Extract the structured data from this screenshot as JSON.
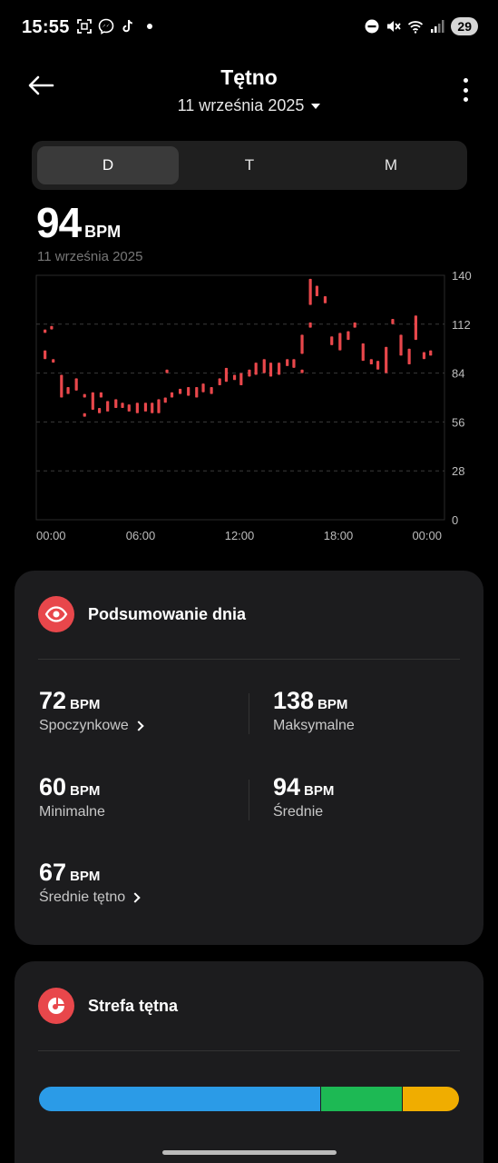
{
  "status_bar": {
    "time": "15:55",
    "battery": "29",
    "left_icons": [
      "screenshot-icon",
      "messenger-icon",
      "tiktok-icon",
      "notification-dot"
    ],
    "right_icons": [
      "dnd-icon",
      "mute-icon",
      "wifi-icon",
      "signal-icon"
    ]
  },
  "header": {
    "title": "Tętno",
    "date": "11 września 2025"
  },
  "tabs": [
    {
      "label": "D",
      "active": true
    },
    {
      "label": "T",
      "active": false
    },
    {
      "label": "M",
      "active": false
    }
  ],
  "summary_value": {
    "value": "94",
    "unit": "BPM",
    "date": "11 września 2025"
  },
  "chart_data": {
    "type": "candlestick-range",
    "x_ticks": [
      "00:00",
      "06:00",
      "12:00",
      "18:00",
      "00:00"
    ],
    "y_ticks": [
      "140",
      "112",
      "84",
      "56",
      "28",
      "0"
    ],
    "ylim": [
      0,
      140
    ],
    "xlim_hours": [
      0,
      24
    ],
    "color": "#e8474b",
    "grid": true,
    "ranges": [
      {
        "h": 0.2,
        "lo": 107,
        "hi": 109
      },
      {
        "h": 0.6,
        "lo": 109,
        "hi": 111
      },
      {
        "h": 0.2,
        "lo": 92,
        "hi": 97
      },
      {
        "h": 0.7,
        "lo": 90,
        "hi": 92
      },
      {
        "h": 1.2,
        "lo": 70,
        "hi": 83
      },
      {
        "h": 1.6,
        "lo": 72,
        "hi": 76
      },
      {
        "h": 2.1,
        "lo": 74,
        "hi": 81
      },
      {
        "h": 2.6,
        "lo": 59,
        "hi": 61
      },
      {
        "h": 2.6,
        "lo": 70,
        "hi": 72
      },
      {
        "h": 3.1,
        "lo": 63,
        "hi": 73
      },
      {
        "h": 3.5,
        "lo": 61,
        "hi": 64
      },
      {
        "h": 3.6,
        "lo": 70,
        "hi": 73
      },
      {
        "h": 4.0,
        "lo": 62,
        "hi": 68
      },
      {
        "h": 4.5,
        "lo": 64,
        "hi": 69
      },
      {
        "h": 4.9,
        "lo": 64,
        "hi": 67
      },
      {
        "h": 5.3,
        "lo": 62,
        "hi": 66
      },
      {
        "h": 5.8,
        "lo": 61,
        "hi": 67
      },
      {
        "h": 6.3,
        "lo": 62,
        "hi": 67
      },
      {
        "h": 6.7,
        "lo": 61,
        "hi": 67
      },
      {
        "h": 7.1,
        "lo": 61,
        "hi": 69
      },
      {
        "h": 7.5,
        "lo": 67,
        "hi": 70
      },
      {
        "h": 7.6,
        "lo": 84,
        "hi": 86
      },
      {
        "h": 7.9,
        "lo": 70,
        "hi": 73
      },
      {
        "h": 8.4,
        "lo": 72,
        "hi": 75
      },
      {
        "h": 8.9,
        "lo": 71,
        "hi": 76
      },
      {
        "h": 9.4,
        "lo": 70,
        "hi": 76
      },
      {
        "h": 9.8,
        "lo": 73,
        "hi": 78
      },
      {
        "h": 10.3,
        "lo": 72,
        "hi": 76
      },
      {
        "h": 10.8,
        "lo": 77,
        "hi": 81
      },
      {
        "h": 11.2,
        "lo": 79,
        "hi": 87
      },
      {
        "h": 11.7,
        "lo": 80,
        "hi": 83
      },
      {
        "h": 12.1,
        "lo": 77,
        "hi": 84
      },
      {
        "h": 12.6,
        "lo": 82,
        "hi": 86
      },
      {
        "h": 13.0,
        "lo": 83,
        "hi": 90
      },
      {
        "h": 13.5,
        "lo": 84,
        "hi": 92
      },
      {
        "h": 13.9,
        "lo": 82,
        "hi": 90
      },
      {
        "h": 14.4,
        "lo": 83,
        "hi": 90
      },
      {
        "h": 14.9,
        "lo": 88,
        "hi": 92
      },
      {
        "h": 15.3,
        "lo": 87,
        "hi": 92
      },
      {
        "h": 15.8,
        "lo": 84,
        "hi": 86
      },
      {
        "h": 15.8,
        "lo": 95,
        "hi": 106
      },
      {
        "h": 16.3,
        "lo": 123,
        "hi": 138
      },
      {
        "h": 16.3,
        "lo": 110,
        "hi": 113
      },
      {
        "h": 16.7,
        "lo": 128,
        "hi": 134
      },
      {
        "h": 17.2,
        "lo": 124,
        "hi": 128
      },
      {
        "h": 17.6,
        "lo": 100,
        "hi": 105
      },
      {
        "h": 18.1,
        "lo": 97,
        "hi": 107
      },
      {
        "h": 18.6,
        "lo": 103,
        "hi": 108
      },
      {
        "h": 19.0,
        "lo": 110,
        "hi": 113
      },
      {
        "h": 19.5,
        "lo": 91,
        "hi": 101
      },
      {
        "h": 20.0,
        "lo": 89,
        "hi": 92
      },
      {
        "h": 20.4,
        "lo": 86,
        "hi": 91
      },
      {
        "h": 20.9,
        "lo": 84,
        "hi": 99
      },
      {
        "h": 21.3,
        "lo": 112,
        "hi": 115
      },
      {
        "h": 21.8,
        "lo": 94,
        "hi": 106
      },
      {
        "h": 22.3,
        "lo": 89,
        "hi": 98
      },
      {
        "h": 22.7,
        "lo": 103,
        "hi": 117
      },
      {
        "h": 23.2,
        "lo": 92,
        "hi": 96
      },
      {
        "h": 23.6,
        "lo": 94,
        "hi": 97
      }
    ]
  },
  "day_summary": {
    "title": "Podsumowanie dnia",
    "stats": [
      {
        "value": "72",
        "unit": "BPM",
        "label": "Spoczynkowe",
        "has_arrow": true
      },
      {
        "value": "138",
        "unit": "BPM",
        "label": "Maksymalne",
        "has_arrow": false
      },
      {
        "value": "60",
        "unit": "BPM",
        "label": "Minimalne",
        "has_arrow": false
      },
      {
        "value": "94",
        "unit": "BPM",
        "label": "Średnie",
        "has_arrow": false
      },
      {
        "value": "67",
        "unit": "BPM",
        "label": "Średnie tętno",
        "has_arrow": true
      }
    ]
  },
  "zone_card": {
    "title": "Strefa tętna",
    "zones": [
      {
        "share": 0.67,
        "color": "#2b9be7"
      },
      {
        "share": 0.195,
        "color": "#1db954"
      },
      {
        "share": 0.135,
        "color": "#f0ad00"
      }
    ]
  }
}
